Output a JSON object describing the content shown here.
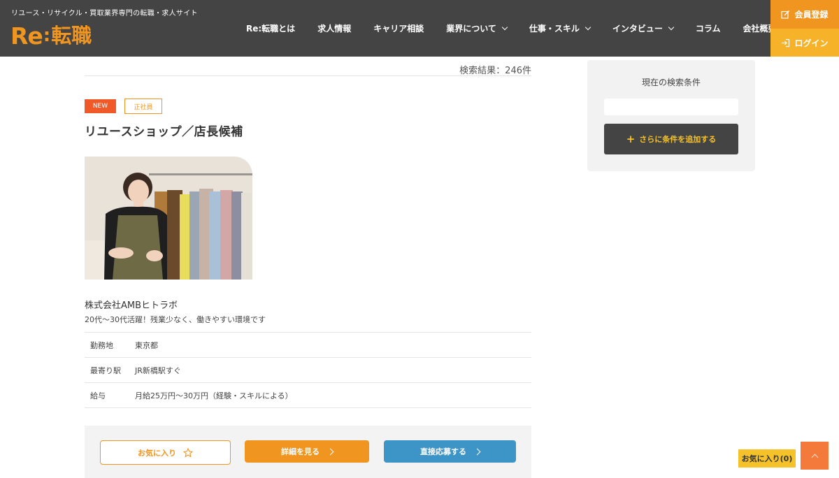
{
  "header": {
    "tagline": "リユース・リサイクル・買取業界専門の転職・求人サイト",
    "logo": {
      "re": "Re",
      "colon": ":",
      "jp": "転職"
    },
    "nav": [
      {
        "label": "Re:転職とは",
        "dropdown": false
      },
      {
        "label": "求人情報",
        "dropdown": false
      },
      {
        "label": "キャリア相談",
        "dropdown": false
      },
      {
        "label": "業界について",
        "dropdown": true
      },
      {
        "label": "仕事・スキル",
        "dropdown": true
      },
      {
        "label": "インタビュー",
        "dropdown": true
      },
      {
        "label": "コラム",
        "dropdown": false
      },
      {
        "label": "会社概要",
        "dropdown": false
      }
    ],
    "register_label": "会員登録",
    "login_label": "ログイン"
  },
  "results": {
    "count_text": "検索結果：246件"
  },
  "job": {
    "badge_new": "NEW",
    "badge_type": "正社員",
    "title": "リユースショップ／店長候補",
    "company": "株式会社AMBヒトラボ",
    "catch": "20代〜30代活躍！残業少なく、働きやすい環境です",
    "details": [
      {
        "label": "勤務地",
        "value": "東京都"
      },
      {
        "label": "最寄り駅",
        "value": "JR新橋駅すぐ"
      },
      {
        "label": "給与",
        "value": "月給25万円〜30万円（経験・スキルによる）"
      }
    ],
    "actions": {
      "favorite_label": "お気に入り",
      "detail_label": "詳細を見る",
      "apply_label": "直接応募する"
    }
  },
  "sidebar": {
    "title": "現在の検索条件",
    "add_condition_label": "さらに条件を追加する"
  },
  "floating": {
    "favorites_label": "お気に入り(0)"
  },
  "colors": {
    "header_bg": "#444444",
    "brand_orange": "#f0951f",
    "login_yellow": "#f6b32a",
    "new_badge": "#f05a28",
    "apply_blue": "#3d94c6"
  }
}
